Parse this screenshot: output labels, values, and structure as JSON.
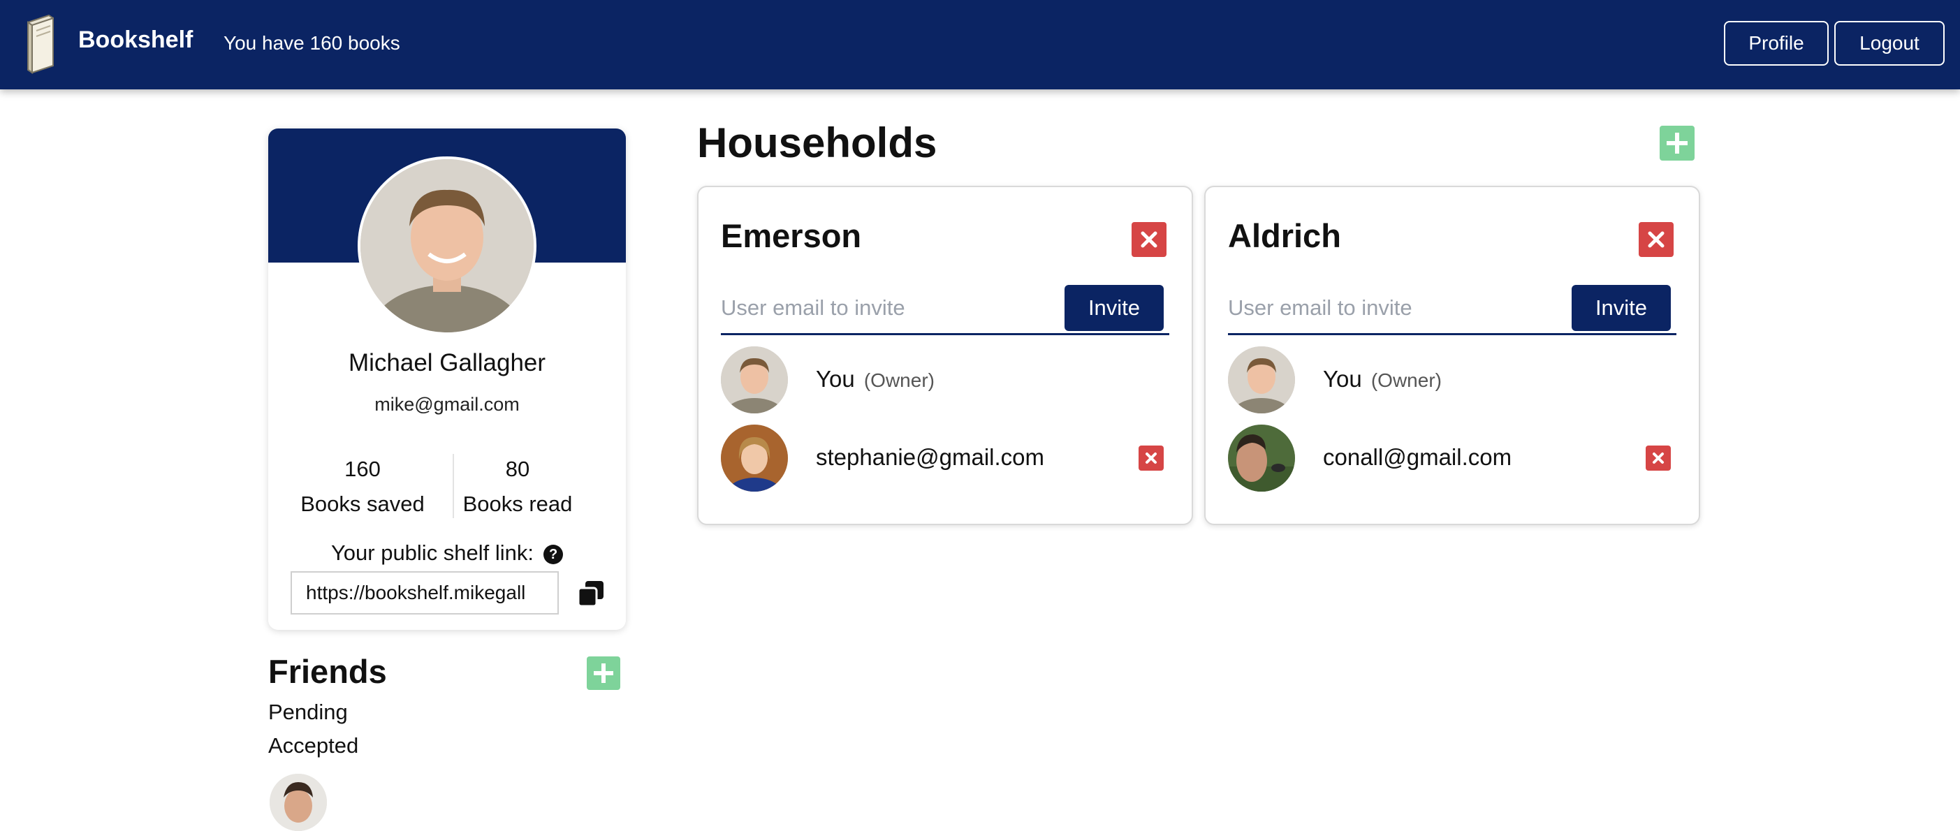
{
  "navbar": {
    "brand": "Bookshelf",
    "book_count_text": "You have 160 books",
    "profile_label": "Profile",
    "logout_label": "Logout"
  },
  "profile": {
    "name": "Michael Gallagher",
    "email": "mike@gmail.com",
    "stats": [
      {
        "value": "160",
        "label": "Books saved"
      },
      {
        "value": "80",
        "label": "Books read"
      }
    ],
    "public_link_label": "Your public shelf link:",
    "help_icon": "?",
    "public_link_value": "https://bookshelf.mikegall"
  },
  "friends": {
    "title": "Friends",
    "pending_label": "Pending",
    "accepted_label": "Accepted"
  },
  "households": {
    "title": "Households",
    "invite_placeholder": "User email to invite",
    "invite_label": "Invite",
    "items": [
      {
        "name": "Emerson",
        "members": [
          {
            "name": "You",
            "role": "(Owner)"
          },
          {
            "name": "stephanie@gmail.com",
            "role": ""
          }
        ]
      },
      {
        "name": "Aldrich",
        "members": [
          {
            "name": "You",
            "role": "(Owner)"
          },
          {
            "name": "conall@gmail.com",
            "role": ""
          }
        ]
      }
    ]
  },
  "colors": {
    "navy": "#0b2463",
    "delete_red": "#d64545",
    "add_green": "#7ed39a"
  },
  "icons": {
    "brand": "book-icon",
    "help": "question-circle-icon",
    "copy": "copy-icon",
    "add": "plus-icon",
    "delete": "close-icon"
  }
}
